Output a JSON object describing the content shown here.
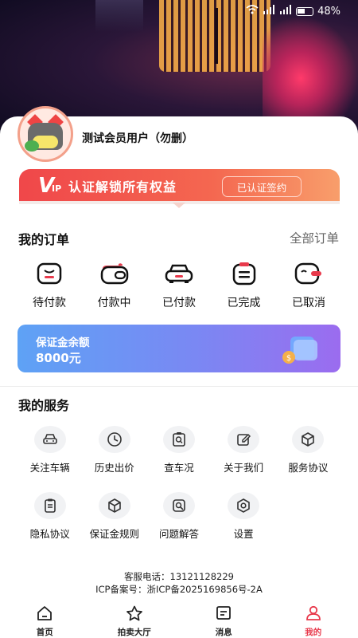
{
  "status_bar": {
    "battery": "48%"
  },
  "profile": {
    "username": "测试会员用户（勿删）"
  },
  "vip": {
    "logo_v": "V",
    "logo_ip": "IP",
    "text": "认证解锁所有权益",
    "button": "已认证签约"
  },
  "orders": {
    "title": "我的订单",
    "all_label": "全部订单",
    "items": [
      {
        "label": "待付款",
        "icon": "pending-payment-icon"
      },
      {
        "label": "付款中",
        "icon": "wallet-icon"
      },
      {
        "label": "已付款",
        "icon": "car-paid-icon"
      },
      {
        "label": "已完成",
        "icon": "completed-doc-icon"
      },
      {
        "label": "已取消",
        "icon": "cancelled-icon"
      }
    ]
  },
  "deposit": {
    "label": "保证金余额",
    "amount": "8000元"
  },
  "services": {
    "title": "我的服务",
    "items": [
      {
        "label": "关注车辆",
        "icon": "car-icon"
      },
      {
        "label": "历史出价",
        "icon": "clock-icon"
      },
      {
        "label": "查车况",
        "icon": "inspect-icon"
      },
      {
        "label": "关于我们",
        "icon": "edit-icon"
      },
      {
        "label": "服务协议",
        "icon": "box-icon"
      },
      {
        "label": "隐私协议",
        "icon": "clipboard-icon"
      },
      {
        "label": "保证金规则",
        "icon": "cube-icon"
      },
      {
        "label": "问题解答",
        "icon": "search-doc-icon"
      },
      {
        "label": "设置",
        "icon": "settings-icon"
      }
    ]
  },
  "footer": {
    "phone": "客服电话：13121128229",
    "icp": "ICP备案号：浙ICP备2025169856号-2A"
  },
  "tabbar": {
    "items": [
      {
        "label": "首页",
        "icon": "home-icon",
        "active": false
      },
      {
        "label": "拍卖大厅",
        "icon": "star-icon",
        "active": false
      },
      {
        "label": "消息",
        "icon": "message-icon",
        "active": false
      },
      {
        "label": "我的",
        "icon": "user-icon",
        "active": true
      }
    ]
  },
  "colors": {
    "accent": "#e83a4c",
    "vip_start": "#f0474a",
    "deposit_start": "#5ea2f5",
    "deposit_end": "#9b6cef"
  }
}
